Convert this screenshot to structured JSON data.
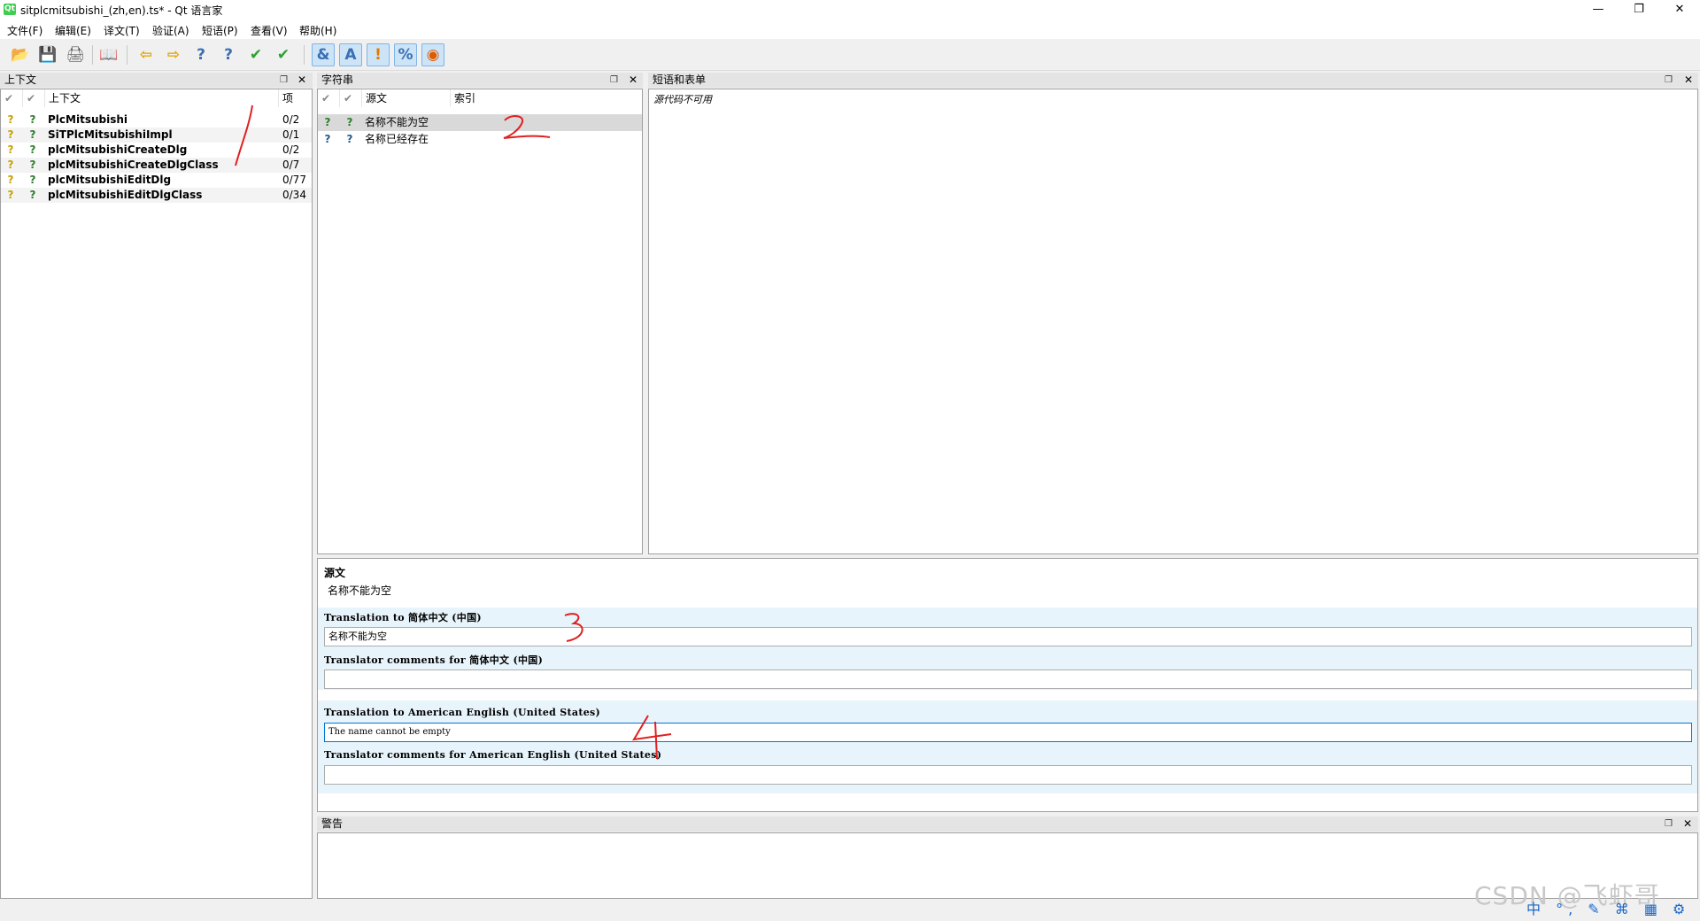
{
  "window": {
    "title": "sitplcmitsubishi_(zh,en).ts* - Qt 语言家",
    "app_icon": "qt-linguist-icon",
    "controls": {
      "minimize": "—",
      "restore": "❐",
      "close": "✕"
    }
  },
  "menu": [
    "文件(F)",
    "编辑(E)",
    "译文(T)",
    "验证(A)",
    "短语(P)",
    "查看(V)",
    "帮助(H)"
  ],
  "toolbar": {
    "buttons": [
      {
        "name": "open-icon",
        "glyph": "📂",
        "active": false
      },
      {
        "name": "save-icon",
        "glyph": "💾",
        "active": false
      },
      {
        "name": "print-icon",
        "glyph": "🖨",
        "active": false
      },
      {
        "name": "phrase-book-icon",
        "glyph": "📖",
        "active": false
      },
      {
        "name": "prev-icon",
        "glyph": "⇦",
        "active": false
      },
      {
        "name": "next-icon",
        "glyph": "⇨",
        "active": false
      },
      {
        "name": "prev-unfinished-icon",
        "glyph": "?",
        "active": false
      },
      {
        "name": "next-unfinished-icon",
        "glyph": "?",
        "active": false
      },
      {
        "name": "done-icon",
        "glyph": "✔",
        "active": false
      },
      {
        "name": "done-and-next-icon",
        "glyph": "✔",
        "active": false
      },
      {
        "name": "accelerator-check-icon",
        "glyph": "&",
        "active": true
      },
      {
        "name": "punctuation-check-icon",
        "glyph": "A",
        "active": true
      },
      {
        "name": "phrase-check-icon",
        "glyph": "!",
        "active": true
      },
      {
        "name": "placeholder-check-icon",
        "glyph": "%",
        "active": true
      },
      {
        "name": "surrounding-check-icon",
        "glyph": "◉",
        "active": true
      }
    ]
  },
  "context_panel": {
    "title": "上下文",
    "headers": {
      "name": "上下文",
      "count": "项"
    },
    "rows": [
      {
        "name": "PlcMitsubishi",
        "count": "0/2"
      },
      {
        "name": "SiTPlcMitsubishiImpl",
        "count": "0/1"
      },
      {
        "name": "plcMitsubishiCreateDlg",
        "count": "0/2"
      },
      {
        "name": "plcMitsubishiCreateDlgClass",
        "count": "0/7"
      },
      {
        "name": "plcMitsubishiEditDlg",
        "count": "0/77"
      },
      {
        "name": "plcMitsubishiEditDlgClass",
        "count": "0/34"
      }
    ]
  },
  "strings_panel": {
    "title": "字符串",
    "headers": {
      "source": "源文",
      "index": "索引"
    },
    "rows": [
      {
        "source": "名称不能为空",
        "selected": true
      },
      {
        "source": "名称已经存在",
        "selected": false
      }
    ]
  },
  "phrases_panel": {
    "title": "短语和表单",
    "message": "源代码不可用"
  },
  "editor": {
    "source_label": "源文",
    "source_text": "名称不能为空",
    "translation_zh_label": "Translation to 简体中文 (中国)",
    "translation_zh_value": "名称不能为空",
    "comments_zh_label": "Translator comments for 简体中文 (中国)",
    "comments_zh_value": "",
    "translation_en_label": "Translation to American English (United States)",
    "translation_en_value": "The name cannot be empty",
    "comments_en_label": "Translator comments for American English (United States)",
    "comments_en_value": ""
  },
  "warnings_panel": {
    "title": "警告"
  },
  "annotations": [
    "1",
    "2",
    "3",
    "4"
  ],
  "watermark": "CSDN @飞虾哥",
  "tray": "中 °, ✎ ⌘ ▦ ⚙",
  "colors": {
    "selection": "#d9d9d9",
    "editor_band": "#e8f4fb",
    "focus": "#0078d7",
    "annotation": "#e02020"
  }
}
